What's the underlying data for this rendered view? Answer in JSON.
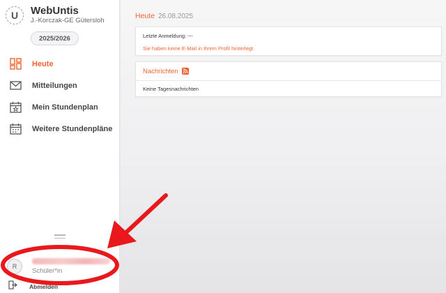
{
  "app": {
    "logo_letter": "U",
    "title": "WebUntis",
    "school": "J.-Korczak-GE Gütersloh",
    "school_year": "2025/2026"
  },
  "nav": {
    "items": [
      {
        "label": "Heute",
        "icon": "dashboard-icon",
        "active": true
      },
      {
        "label": "Mitteilungen",
        "icon": "mail-icon"
      },
      {
        "label": "Mein Stundenplan",
        "icon": "calendar-star-icon"
      },
      {
        "label": "Weitere Stundenpläne",
        "icon": "calendar-grid-icon"
      }
    ]
  },
  "user": {
    "avatar_letter": "R",
    "role": "Schüler*in",
    "logout_label": "Abmelden"
  },
  "main": {
    "title": "Heute",
    "date": "26.08.2025",
    "login_info": "Letzte Anmeldung: ---",
    "email_warning": "Sie haben keine E-Mail in ihrem Profil hinterlegt.",
    "news_title": "Nachrichten",
    "news_empty": "Keine Tagesnachrichten"
  },
  "colors": {
    "accent": "#f0642e",
    "annotation": "#e8181c"
  }
}
